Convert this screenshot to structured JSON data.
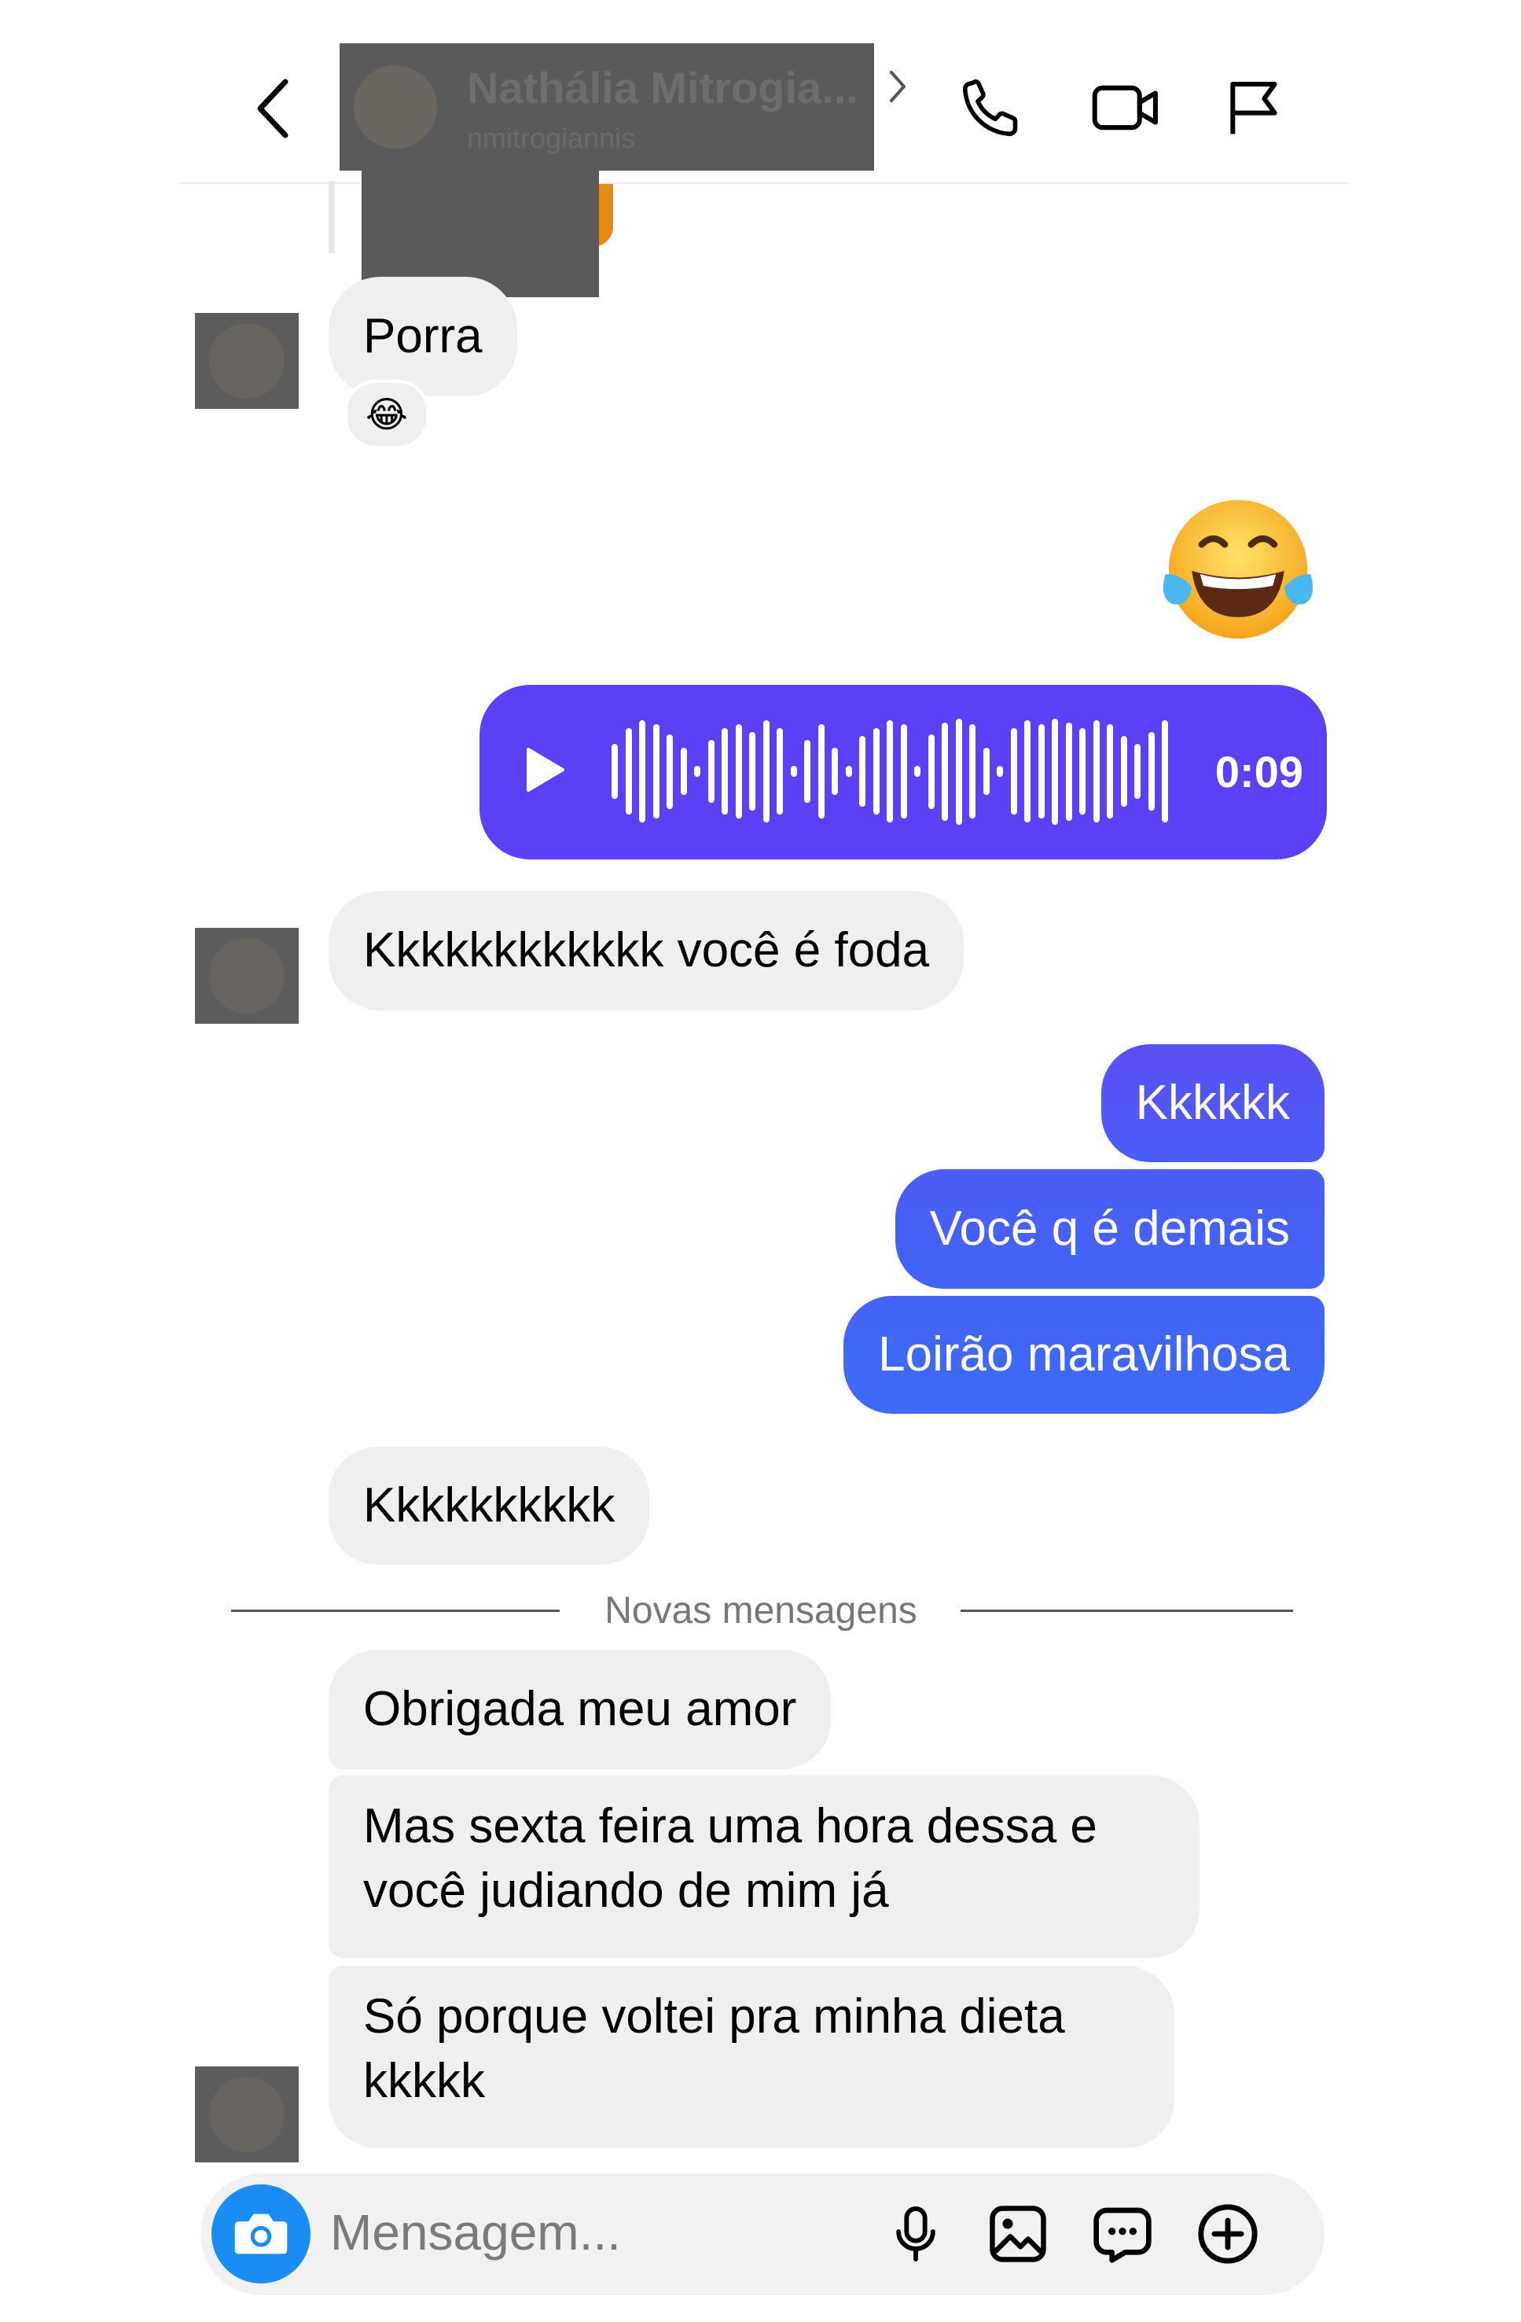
{
  "header": {
    "contact_name": "Nathália Mitrogia...",
    "contact_username": "nmitrogiannis"
  },
  "colors": {
    "incoming_bubble": "#efefef",
    "outgoing_gradient_top": "#6f35f0",
    "outgoing_gradient_bottom": "#3f6af7",
    "voice_note": "#5a41f5",
    "camera_button": "#1a8df5"
  },
  "icons": {
    "back": "chevron-left-icon",
    "call": "phone-icon",
    "video": "video-camera-icon",
    "report": "flag-icon",
    "reaction": "face-with-tears-of-joy-emoji",
    "camera": "camera-icon",
    "mic": "microphone-icon",
    "gallery": "image-icon",
    "sticker": "chat-bubble-icon",
    "add": "plus-circle-icon"
  },
  "messages": [
    {
      "id": "m1",
      "direction": "in",
      "text": "Porra",
      "reaction": "😂"
    },
    {
      "id": "m2",
      "direction": "out",
      "emoji": "😂"
    },
    {
      "id": "m3",
      "direction": "out",
      "type": "voice",
      "duration": "0:09"
    },
    {
      "id": "m4",
      "direction": "in",
      "text": "Kkkkkkkkkkkk você é foda"
    },
    {
      "id": "m5",
      "direction": "out",
      "text": "Kkkkkk"
    },
    {
      "id": "m6",
      "direction": "out",
      "text": "Você q é demais"
    },
    {
      "id": "m7",
      "direction": "out",
      "text": "Loirão maravilhosa"
    },
    {
      "id": "m8",
      "direction": "in",
      "text": "Kkkkkkkkkk"
    },
    {
      "id": "m9",
      "direction": "in",
      "text": "Obrigada meu amor"
    },
    {
      "id": "m10",
      "direction": "in",
      "text": "Mas sexta feira uma hora dessa e você judiando de mim já"
    },
    {
      "id": "m11",
      "direction": "in",
      "text": "Só porque voltei pra minha dieta kkkkk"
    }
  ],
  "new_messages_label": "Novas mensagens",
  "composer": {
    "placeholder": "Mensagem..."
  }
}
